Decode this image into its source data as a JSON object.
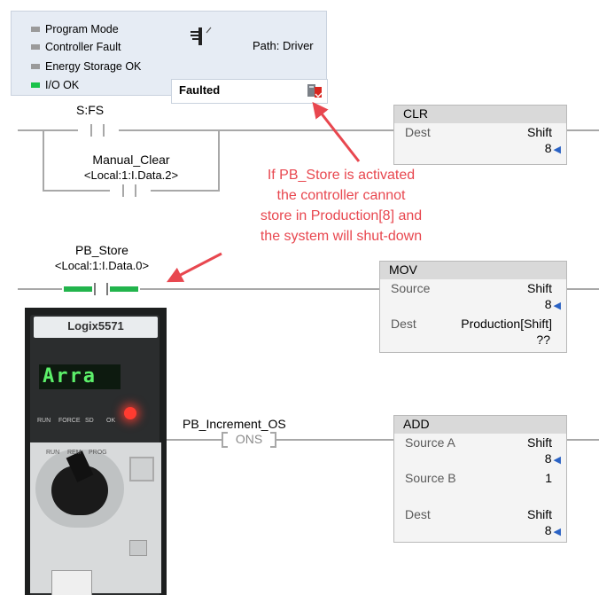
{
  "status_panel": {
    "indicators": [
      {
        "label": "Program Mode",
        "state": "off"
      },
      {
        "label": "Controller Fault",
        "state": "off"
      },
      {
        "label": "Energy Storage OK",
        "state": "off"
      },
      {
        "label": "I/O OK",
        "state": "on"
      }
    ],
    "path_label": "Path: Driver",
    "status_text": "Faulted"
  },
  "rung0": {
    "contact_tag": "S:FS",
    "branch_tag": "Manual_Clear",
    "branch_address": "<Local:1:I.Data.2>",
    "clr": {
      "name": "CLR",
      "dest_label": "Dest",
      "dest_tag": "Shift",
      "dest_value": "8"
    }
  },
  "rung1": {
    "contact_tag": "PB_Store",
    "contact_address": "<Local:1:I.Data.0>",
    "mov": {
      "name": "MOV",
      "source_label": "Source",
      "source_tag": "Shift",
      "source_value": "8",
      "dest_label": "Dest",
      "dest_tag": "Production[Shift]",
      "dest_value": "??"
    }
  },
  "rung2": {
    "ons_tag": "PB_Increment_OS",
    "ons_label": "ONS",
    "add": {
      "name": "ADD",
      "a_label": "Source A",
      "a_tag": "Shift",
      "a_value": "8",
      "b_label": "Source B",
      "b_value": "1",
      "dest_label": "Dest",
      "dest_tag": "Shift",
      "dest_value": "8"
    }
  },
  "annotation": [
    "If PB_Store is activated",
    "the controller cannot",
    "store in Production[8] and",
    "the system will shut-down"
  ],
  "controller": {
    "model": "Logix5571",
    "display": "Arra",
    "status_leds": [
      "RUN",
      "FORCE",
      "SD",
      "OK"
    ],
    "keyswitch": [
      "RUN",
      "REM",
      "PROG"
    ]
  },
  "colors": {
    "annotation": "#e8474f",
    "led_on": "#19c24a",
    "rung_line": "#a8a8a8",
    "arrow_blue": "#2a62c4"
  }
}
